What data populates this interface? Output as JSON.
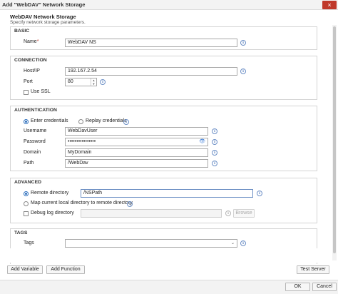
{
  "window": {
    "title": "Add \"WebDAV\" Network Storage",
    "close_icon": "×"
  },
  "header": {
    "title": "WebDAV Network Storage",
    "subtitle": "Specify network storage parameters."
  },
  "basic": {
    "title": "BASIC",
    "name_label": "Name",
    "name_required": "*",
    "name_value": "WebDAV NS"
  },
  "connection": {
    "title": "CONNECTION",
    "host_label": "Host/IP",
    "host_value": "192.167.2.54",
    "port_label": "Port",
    "port_value": "80",
    "ssl_label": "Use SSL"
  },
  "authentication": {
    "title": "AUTHENTICATION",
    "enter_credentials": "Enter credentials",
    "replay_credentials": "Replay credentials",
    "username_label": "Username",
    "username_value": "WebDavUser",
    "password_label": "Password",
    "password_value": "••••••••••••••••",
    "domain_label": "Domain",
    "domain_value": "MyDomain",
    "path_label": "Path",
    "path_value": "/WebDav"
  },
  "advanced": {
    "title": "ADVANCED",
    "remote_directory": "Remote directory",
    "remote_value": "/NSPath",
    "map_local": "Map current local directory to remote directory",
    "debug_log": "Debug log directory",
    "browse": "Browse"
  },
  "tags": {
    "title": "TAGS",
    "tags_label": "Tags",
    "tags_value": ""
  },
  "footer": {
    "add_variable": "Add Variable",
    "add_function": "Add Function",
    "test_server": "Test Server",
    "ok": "OK",
    "cancel": "Cancel"
  },
  "icons": {
    "info": "i",
    "eye": "👁",
    "chevron": "⌄"
  },
  "colors": {
    "accent": "#2d6fbd",
    "close": "#c0392b"
  }
}
